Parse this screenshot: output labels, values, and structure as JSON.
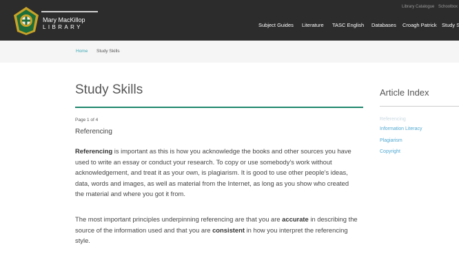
{
  "header": {
    "logo": {
      "line1": "Mary MacKillop",
      "line2": "LIBRARY"
    },
    "utility_links": [
      "Library Catalogue",
      "Schoolbox"
    ],
    "nav_items": [
      "Subject Guides",
      "Literature",
      "TASC English",
      "Databases",
      "Croagh Patrick",
      "Study Skills"
    ]
  },
  "breadcrumb": {
    "home": "Home",
    "current": "Study Skills"
  },
  "article": {
    "title": "Study Skills",
    "page_label": "Page 1 of 4",
    "section_title": "Referencing",
    "p1_bold": "Referencing",
    "p1_rest": " is important as this is how you acknowledge the books and other sources you have used to write an essay or conduct your research. To copy or use somebody's work without acknowledgement, and treat it as your own, is plagiarism. It is good to use other people's ideas, data, words and images, as well as material from the Internet, as long as you show who created the material and where you got it from.",
    "p2_a": "The most important principles underpinning referencing are that you are ",
    "p2_b1": "accurate",
    "p2_c": " in describing the source of the information used and that you are ",
    "p2_b2": "consistent",
    "p2_d": " in how you interpret the referencing style."
  },
  "article_index": {
    "title": "Article Index",
    "items": [
      "Referencing",
      "Information Literacy",
      "Plagiarism",
      "Copyright"
    ]
  },
  "colors": {
    "accent": "#1a8469",
    "link": "#4fa8d1",
    "topbar": "#2c2c2c"
  },
  "icons": {
    "crest": "school-crest-icon"
  }
}
